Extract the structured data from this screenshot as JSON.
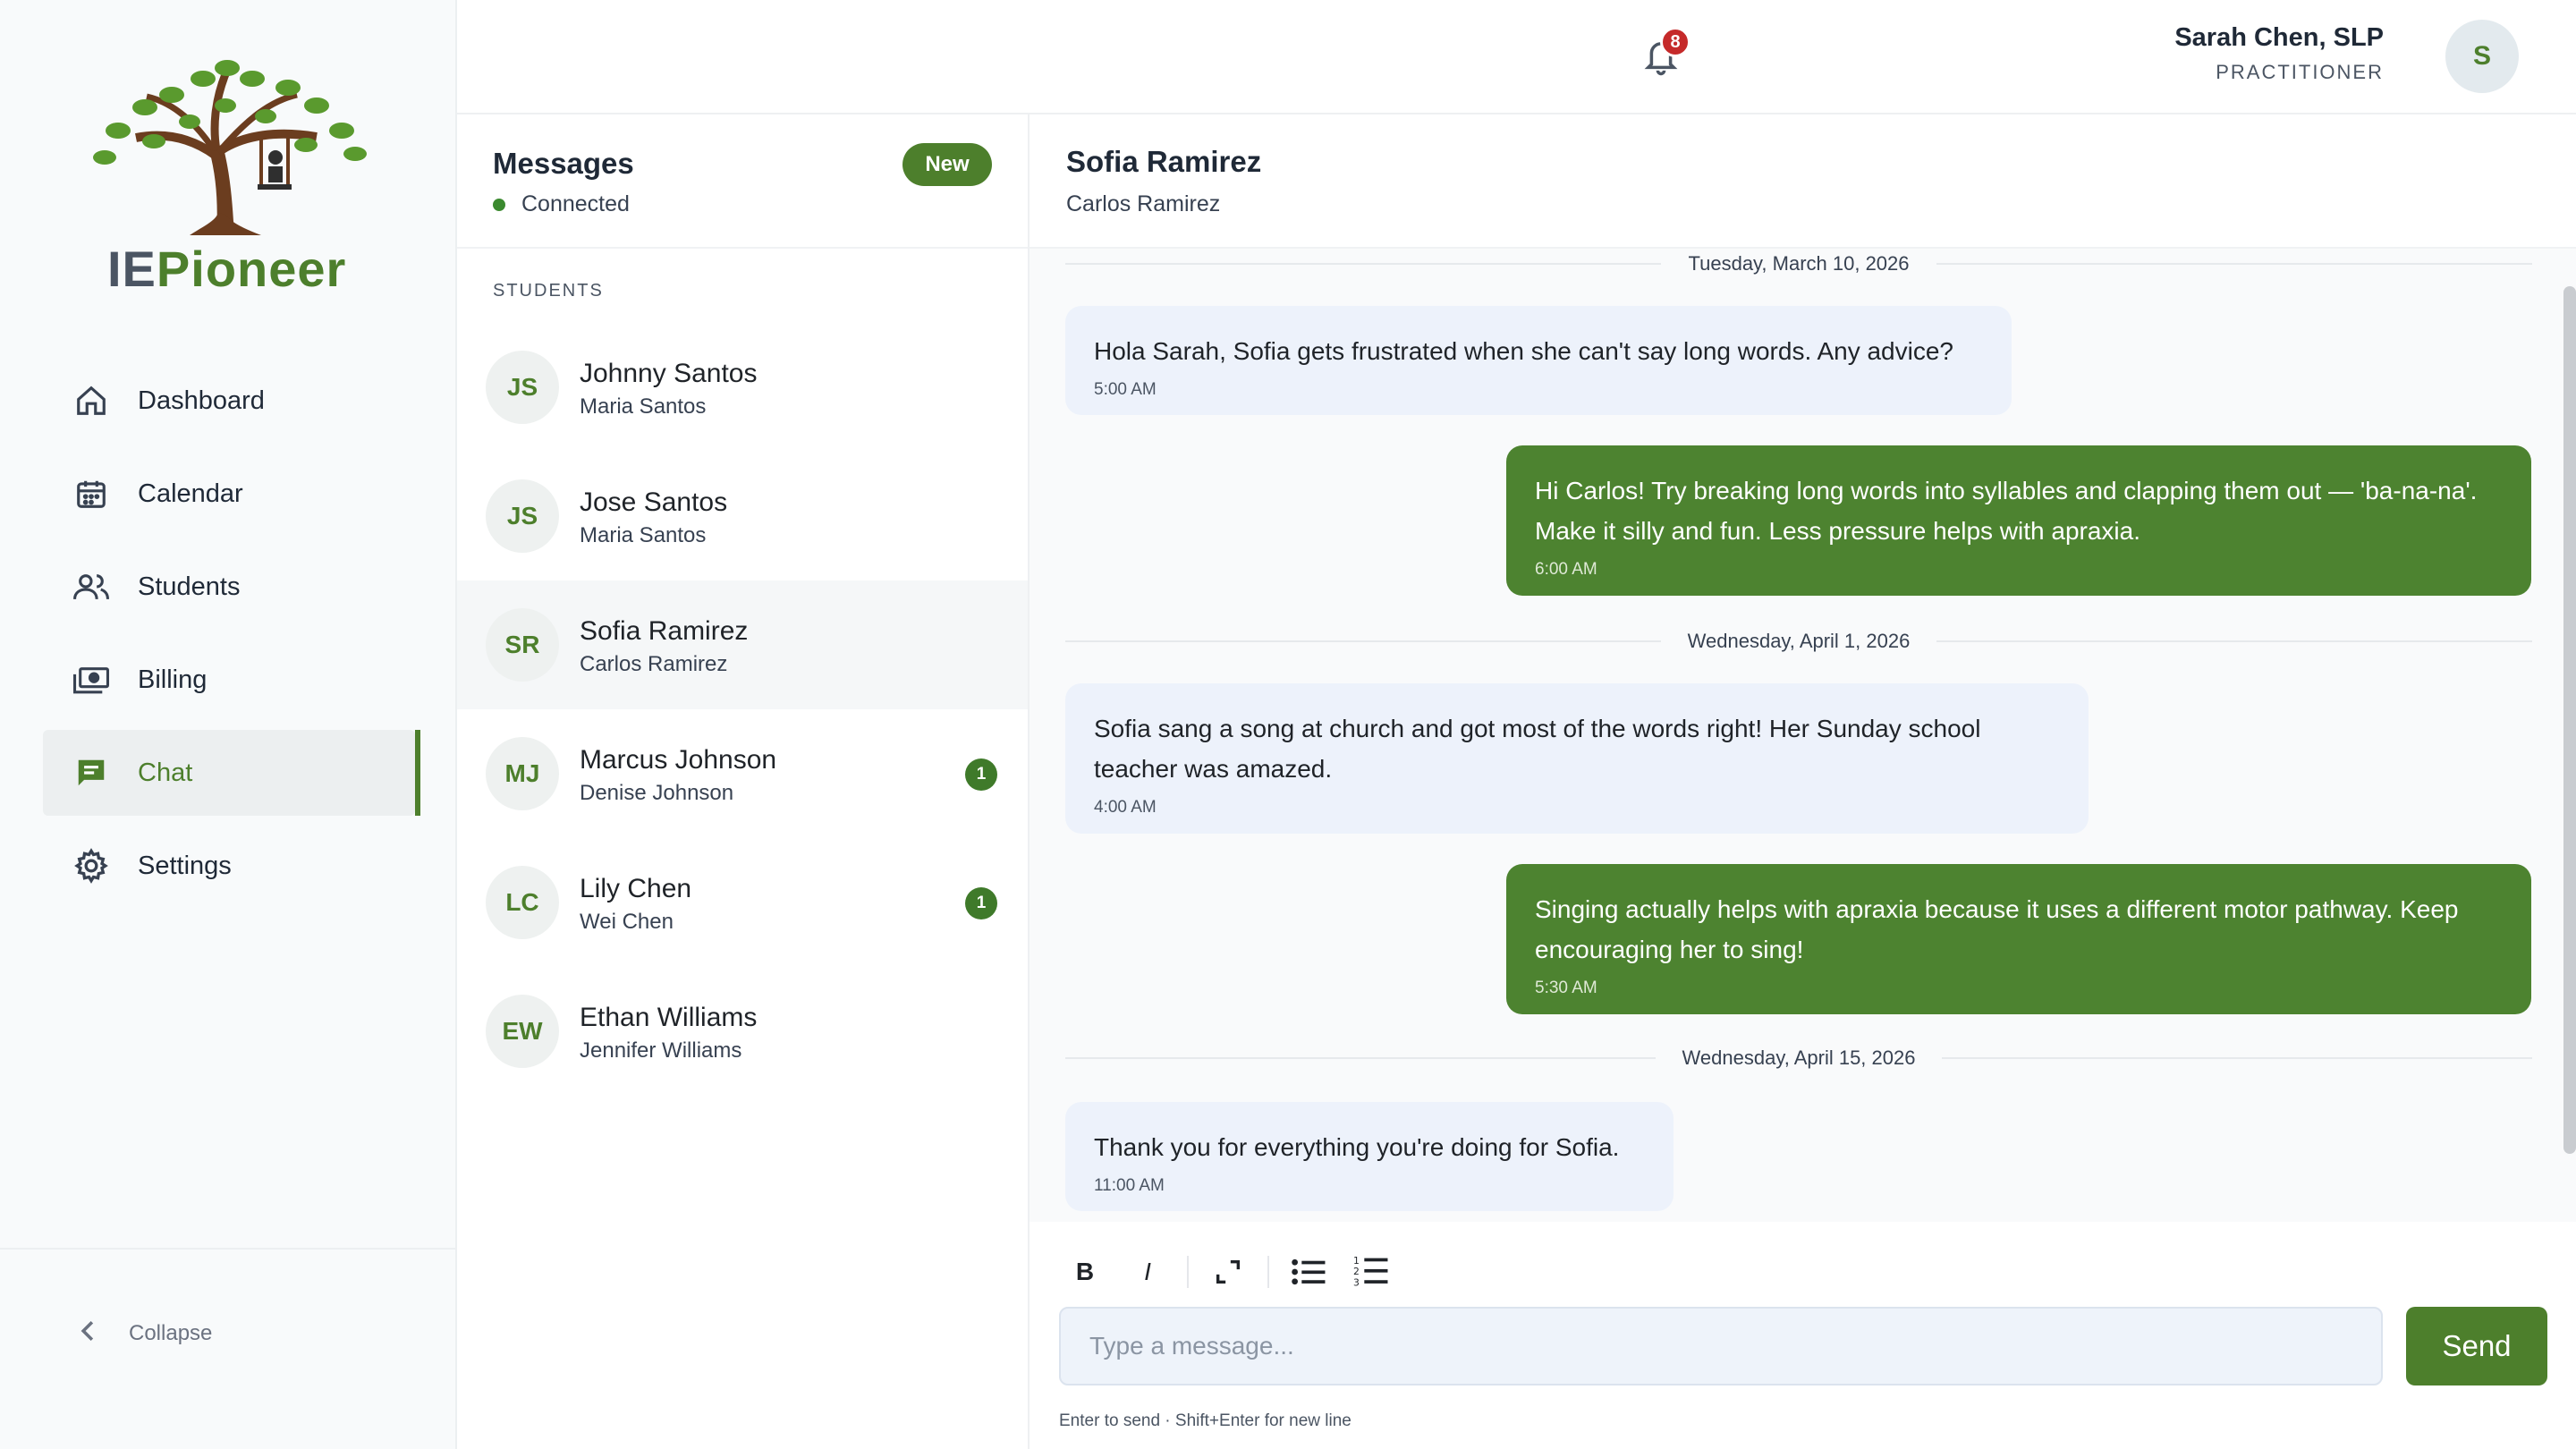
{
  "brand": {
    "logo_ie": "IE",
    "logo_rest": "Pioneer"
  },
  "nav": {
    "items": [
      {
        "label": "Dashboard",
        "icon": "home-icon"
      },
      {
        "label": "Calendar",
        "icon": "calendar-icon"
      },
      {
        "label": "Students",
        "icon": "users-icon"
      },
      {
        "label": "Billing",
        "icon": "money-icon"
      },
      {
        "label": "Chat",
        "icon": "chat-icon",
        "active": true
      },
      {
        "label": "Settings",
        "icon": "gear-icon"
      }
    ],
    "collapse_label": "Collapse"
  },
  "header": {
    "notification_count": "8",
    "user_name": "Sarah Chen, SLP",
    "user_role": "PRACTITIONER",
    "avatar_initial": "S"
  },
  "conversations": {
    "title": "Messages",
    "status": "Connected",
    "new_label": "New",
    "section_label": "STUDENTS",
    "items": [
      {
        "initials": "JS",
        "student": "Johnny Santos",
        "parent": "Maria Santos",
        "unread": ""
      },
      {
        "initials": "JS",
        "student": "Jose Santos",
        "parent": "Maria Santos",
        "unread": ""
      },
      {
        "initials": "SR",
        "student": "Sofia Ramirez",
        "parent": "Carlos Ramirez",
        "unread": "",
        "selected": true
      },
      {
        "initials": "MJ",
        "student": "Marcus Johnson",
        "parent": "Denise Johnson",
        "unread": "1"
      },
      {
        "initials": "LC",
        "student": "Lily Chen",
        "parent": "Wei Chen",
        "unread": "1"
      },
      {
        "initials": "EW",
        "student": "Ethan Williams",
        "parent": "Jennifer Williams",
        "unread": ""
      }
    ]
  },
  "chat": {
    "student": "Sofia Ramirez",
    "parent": "Carlos Ramirez",
    "dates": [
      "Tuesday, March 10, 2026",
      "Wednesday, April 1, 2026",
      "Wednesday, April 15, 2026"
    ],
    "messages": [
      {
        "text": "Hola Sarah, Sofia gets frustrated when she can't say long words. Any advice?",
        "time": "5:00 AM",
        "direction": "in"
      },
      {
        "text": "Hi Carlos! Try breaking long words into syllables and clapping them out — 'ba-na-na'. Make it silly and fun. Less pressure helps with apraxia.",
        "time": "6:00 AM",
        "direction": "out"
      },
      {
        "text": "Sofia sang a song at church and got most of the words right! Her Sunday school teacher was amazed.",
        "time": "4:00 AM",
        "direction": "in"
      },
      {
        "text": "Singing actually helps with apraxia because it uses a different motor pathway. Keep encouraging her to sing!",
        "time": "5:30 AM",
        "direction": "out"
      },
      {
        "text": "Thank you for everything you're doing for Sofia.",
        "time": "11:00 AM",
        "direction": "in"
      }
    ]
  },
  "composer": {
    "bold": "B",
    "italic": "I",
    "placeholder": "Type a message...",
    "send_label": "Send",
    "hint": "Enter to send · Shift+Enter for new line"
  }
}
